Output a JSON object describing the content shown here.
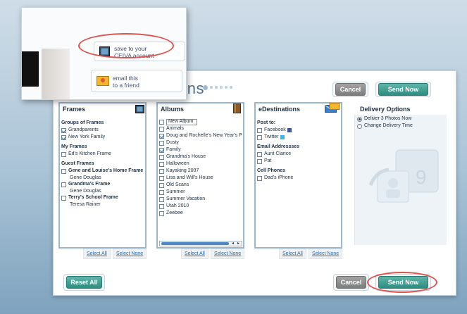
{
  "inset": {
    "save_line1": "save to your",
    "save_line2": "CEIVA account",
    "email_line1": "email this",
    "email_line2": "to a friend"
  },
  "page": {
    "title_fragment": "tions"
  },
  "top_buttons": {
    "cancel": "Cancel",
    "send": "Send Now"
  },
  "bottom_buttons": {
    "reset": "Reset All",
    "cancel": "Cancel",
    "send": "Send Now"
  },
  "frames": {
    "heading": "Frames",
    "groups_label": "Groups of Frames",
    "groups": [
      {
        "label": "Grandparents",
        "checked": true
      },
      {
        "label": "New York Family",
        "checked": true
      }
    ],
    "my_frames_label": "My Frames",
    "my_frames": [
      {
        "label": "Ed's Kitchen Frame",
        "checked": false
      }
    ],
    "guest_label": "Guest Frames",
    "guest": [
      {
        "label": "Gene and Louise's Home Frame",
        "owner": "Gene Douglas"
      },
      {
        "label": "Grandma's Frame",
        "owner": "Gene Douglas"
      },
      {
        "label": "Terry's School Frame",
        "owner": "Teresa Rainer"
      }
    ],
    "select_all": "Select All",
    "select_none": "Select None"
  },
  "albums": {
    "heading": "Albums",
    "new_album": "New Album",
    "items": [
      {
        "label": "Animals",
        "checked": false
      },
      {
        "label": "Doug and Rochelle's New Year's P",
        "checked": true
      },
      {
        "label": "Dusty",
        "checked": false
      },
      {
        "label": "Family",
        "checked": true
      },
      {
        "label": "Grandma's House",
        "checked": false
      },
      {
        "label": "Halloween",
        "checked": false
      },
      {
        "label": "Kayaking 2007",
        "checked": false
      },
      {
        "label": "Lisa and Will's House",
        "checked": false
      },
      {
        "label": "Old Scans",
        "checked": false
      },
      {
        "label": "Summer",
        "checked": false
      },
      {
        "label": "Summer Vacation",
        "checked": false
      },
      {
        "label": "Utah 2010",
        "checked": false
      },
      {
        "label": "Zeebee",
        "checked": false
      }
    ],
    "select_all": "Select All",
    "select_none": "Select None"
  },
  "edestinations": {
    "heading": "eDestinations",
    "post_label": "Post to:",
    "post": [
      {
        "label": "Facebook"
      },
      {
        "label": "Twitter"
      }
    ],
    "email_label": "Email Addressses",
    "emails": [
      {
        "label": "Aunt Clarice"
      },
      {
        "label": "Pat"
      }
    ],
    "cell_label": "Cell Phones",
    "cells": [
      {
        "label": "Dad's iPhone"
      }
    ],
    "select_all": "Select All",
    "select_none": "Select None"
  },
  "delivery": {
    "heading": "Delivery Options",
    "options": [
      {
        "label": "Deliver 3 Photos Now",
        "selected": true
      },
      {
        "label": "Change Delivery Time",
        "selected": false
      }
    ]
  },
  "colors": {
    "accent_teal": "#2f8c80",
    "highlight_oval": "#d9534f",
    "panel_border": "#9cb6cc"
  }
}
